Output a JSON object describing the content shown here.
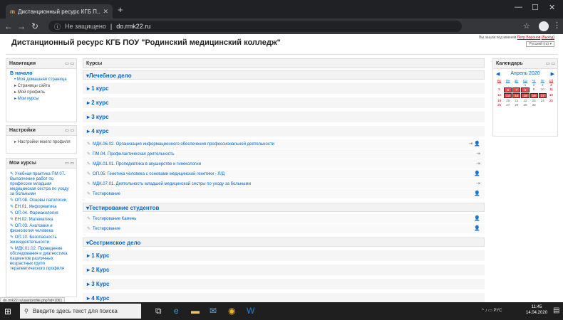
{
  "browser": {
    "tab_title": "Дистанционный ресурс КГБ П...",
    "tab_favicon": "moodle-icon",
    "address_secure_text": "Не защищено",
    "address_url": "do.rmk22.ru"
  },
  "header": {
    "site_title": "Дистанционный ресурс КГБ ПОУ \"Родинский медицинский колледж\"",
    "login_prefix": "Вы зашли под именем",
    "user_name": "Петр Воронов",
    "logout": "(Выход)",
    "language": "Русский (ru) ▾"
  },
  "nav_block": {
    "title": "Навигация",
    "home": "В начало",
    "items": [
      "Моя домашняя страница",
      "Страницы сайта",
      "Мой профиль",
      "Мои курсы"
    ]
  },
  "settings_block": {
    "title": "Настройки",
    "items": [
      "Настройки моего профиля"
    ]
  },
  "my_courses_block": {
    "title": "Мои курсы",
    "items": [
      "Учебная практика ПМ 07. Выполнение работ по профессии младшая медицинская сестра по уходу за больными",
      "ОП.08. Основы патологии",
      "ЕН.01. Информатика",
      "ОП.04. Фармакология",
      "ЕН.02. Математика",
      "ОП.03. Анатомия и физиология человека",
      "ОП.10. Безопасность жизнедеятельности",
      "МДК.01.02. Проведение обследования и диагностика пациентов различных возрастных групп терапевтического профиля"
    ]
  },
  "main": {
    "title": "Курсы",
    "categories": [
      {
        "name": "Лечебное дело",
        "subs_top": [
          "1 курс",
          "2 курс",
          "3 курс",
          "4 курс"
        ],
        "courses": [
          {
            "name": "МДК.06.02. Организация информационного обеспечения профессиональной деятельности",
            "icon": "login-user-icon"
          },
          {
            "name": "ПМ.04. Профилактическая деятельность",
            "icon": "login-icon"
          },
          {
            "name": "МДК.01.01. Пропедевтика в акушерстве и гинекологии",
            "icon": "login-icon"
          },
          {
            "name": "ОП.05. Генетика человека с основами медицинской генетики - Л/Д",
            "icon": "user-icon"
          },
          {
            "name": "МДК.07.01. Деятельность младшей медицинской сестры по уходу за больными",
            "icon": "login-icon"
          },
          {
            "name": "Тестирование",
            "icon": "user-icon"
          }
        ]
      },
      {
        "name": "Тестирование студентов",
        "courses": [
          {
            "name": "Тестирование Камень",
            "icon": "user-icon"
          },
          {
            "name": "Тестирование",
            "icon": "user-icon"
          }
        ]
      },
      {
        "name": "Сестринское дело",
        "subs": [
          "1 Курс",
          "2 Курс",
          "3 Курс",
          "4 Курс"
        ]
      }
    ]
  },
  "calendar": {
    "title": "Календарь",
    "month": "Апрель 2020",
    "weekdays": [
      "Вс",
      "Пн",
      "Вт",
      "Ср",
      "Чт",
      "Пт",
      "Сб"
    ],
    "days": [
      "",
      "",
      "",
      "1",
      "2",
      "3",
      "4",
      "5",
      "6",
      "7",
      "8",
      "9",
      "10",
      "11",
      "12",
      "13",
      "14",
      "15",
      "16",
      "17",
      "18",
      "19",
      "20",
      "21",
      "22",
      "23",
      "24",
      "25",
      "26",
      "27",
      "28",
      "29",
      "30",
      "",
      ""
    ],
    "event_days": [
      "6",
      "7",
      "8",
      "13",
      "14",
      "15",
      "16",
      "17"
    ]
  },
  "status_url": "do.rmk22.ru/user/profile.php?id=1061",
  "taskbar": {
    "search_placeholder": "Введите здесь текст для поиска",
    "lang": "РУС",
    "time": "11:45",
    "date": "14.04.2020"
  }
}
